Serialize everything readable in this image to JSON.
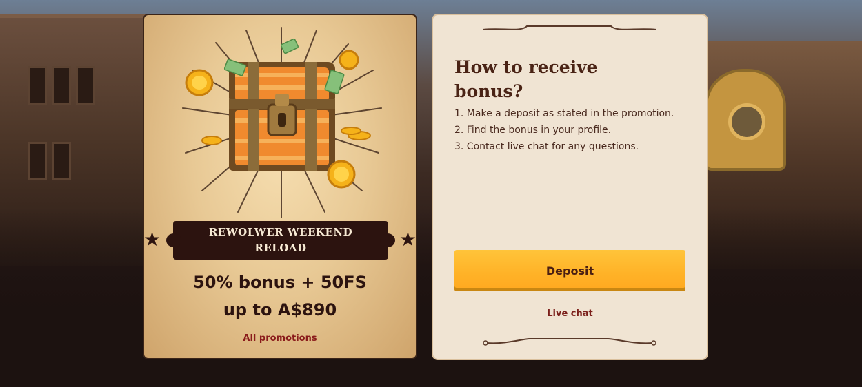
{
  "promo": {
    "title": "REWOLWER WEEKEND RELOAD",
    "offer_line1": "50% bonus + 50FS",
    "offer_line2": "up to A$890",
    "link_label": "All promotions"
  },
  "info": {
    "title": "How to receive bonus?",
    "steps": [
      "1. Make a deposit as stated in the promotion.",
      "2. Find the bonus in your profile.",
      "3. Contact live chat for any questions."
    ],
    "deposit_label": "Deposit",
    "live_chat_label": "Live chat"
  },
  "colors": {
    "accent_button": "#ffb328",
    "card_dark": "#2c130f",
    "link_red": "#8a1b1b",
    "info_bg": "#f0e4d3"
  },
  "icons": [
    "treasure-chest-icon",
    "gold-coin-icon",
    "cash-bill-icon",
    "star-icon"
  ]
}
